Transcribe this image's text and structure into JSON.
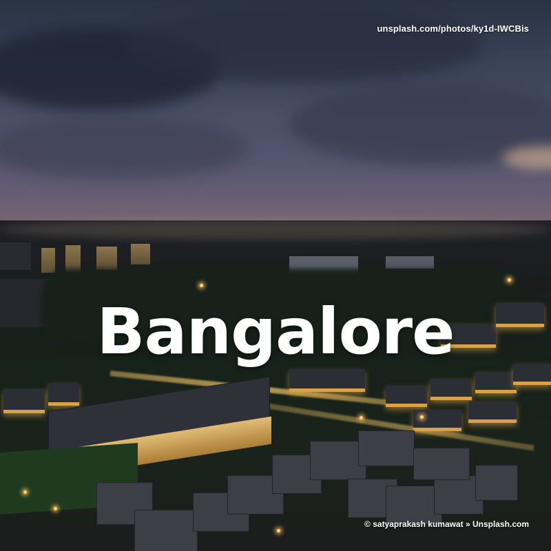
{
  "photo": {
    "title": "Bangalore",
    "source_url_text": "unsplash.com/photos/ky1d-IWCBis",
    "credit_text": "© satyaprakash kumawat » Unsplash.com"
  }
}
